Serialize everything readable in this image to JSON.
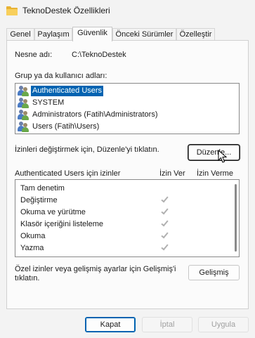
{
  "window": {
    "title": "TeknoDestek Özellikleri"
  },
  "tabs": [
    {
      "label": "Genel"
    },
    {
      "label": "Paylaşım"
    },
    {
      "label": "Güvenlik"
    },
    {
      "label": "Önceki Sürümler"
    },
    {
      "label": "Özelleştir"
    }
  ],
  "active_tab": "Güvenlik",
  "object": {
    "label": "Nesne adı:",
    "value": "C:\\TeknoDestek"
  },
  "groups": {
    "label": "Grup ya da kullanıcı adları:",
    "items": [
      {
        "label": "Authenticated Users",
        "icon": "users-icon",
        "selected": true
      },
      {
        "label": "SYSTEM",
        "icon": "users-icon",
        "selected": false
      },
      {
        "label": "Administrators (Fatih\\Administrators)",
        "icon": "users-icon",
        "selected": false
      },
      {
        "label": "Users (Fatih\\Users)",
        "icon": "users-icon",
        "selected": false
      }
    ]
  },
  "edit": {
    "hint": "İzinleri değiştirmek için, Düzenle'yi tıklatın.",
    "button_label": "Düzenle..."
  },
  "permissions": {
    "title": "Authenticated Users için izinler",
    "col_allow": "İzin Ver",
    "col_deny": "İzin Verme",
    "rows": [
      {
        "name": "Tam denetim",
        "allow": false,
        "deny": false
      },
      {
        "name": "Değiştirme",
        "allow": true,
        "deny": false
      },
      {
        "name": "Okuma ve yürütme",
        "allow": true,
        "deny": false
      },
      {
        "name": "Klasör içeriğini listeleme",
        "allow": true,
        "deny": false
      },
      {
        "name": "Okuma",
        "allow": true,
        "deny": false
      },
      {
        "name": "Yazma",
        "allow": true,
        "deny": false
      }
    ]
  },
  "advanced": {
    "hint_line1": "Özel izinler veya gelişmiş ayarlar için Gelişmiş'i",
    "hint_line2": "tıklatın.",
    "button_label": "Gelişmiş"
  },
  "footer": {
    "ok_label": "Kapat",
    "cancel_label": "İptal",
    "apply_label": "Uygula"
  },
  "colors": {
    "selection": "#0063b1",
    "checkmark_disabled": "#b0b0b0",
    "folder": "#f8cf5c"
  }
}
